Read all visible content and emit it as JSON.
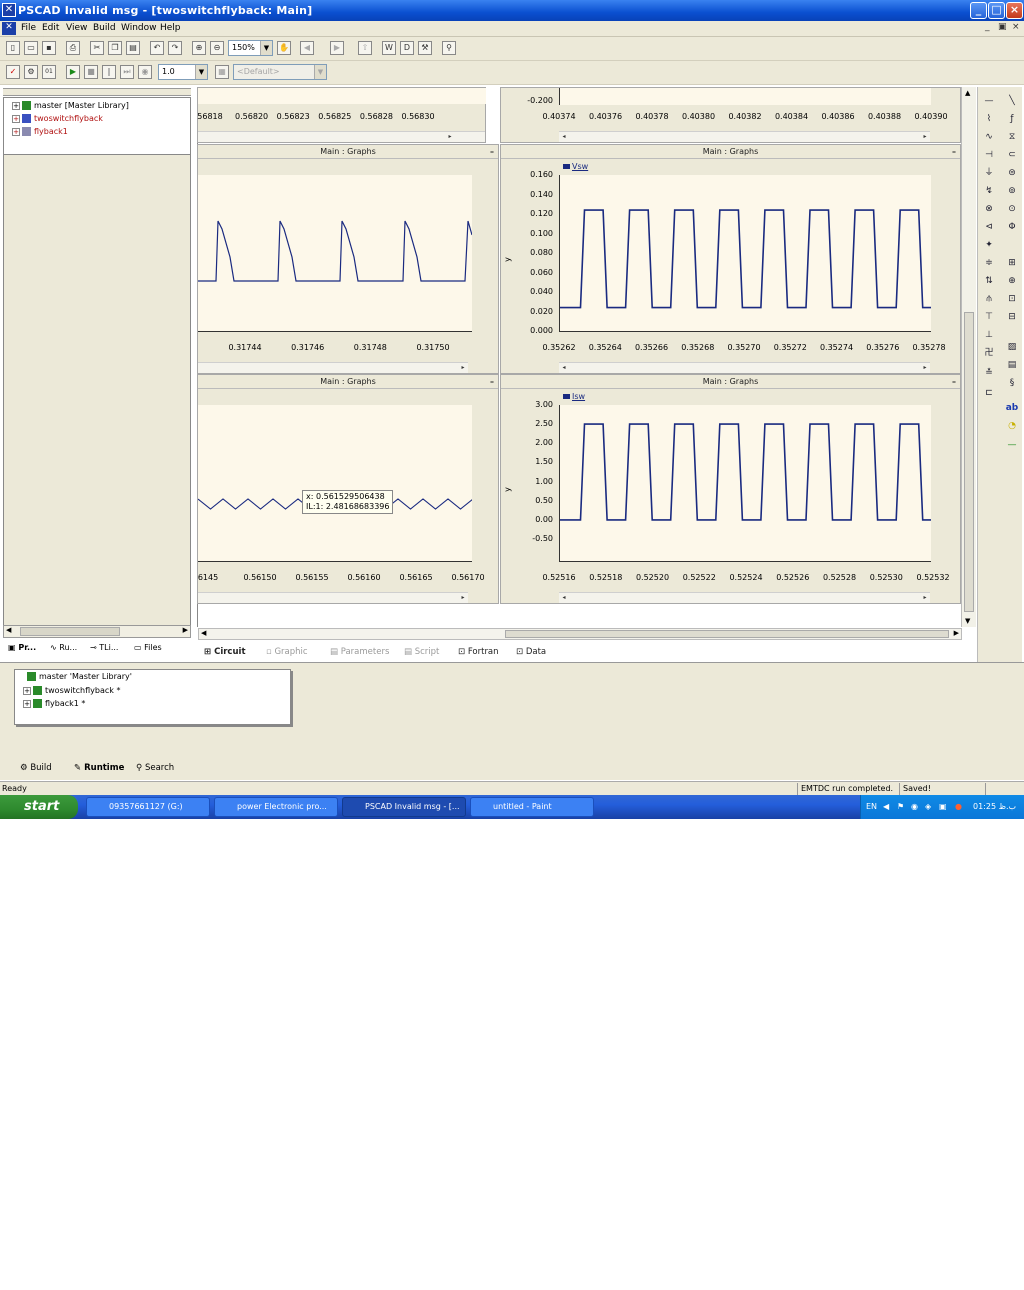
{
  "window": {
    "title": "PSCAD Invalid msg - [twoswitchflyback: Main]"
  },
  "menu": [
    "File",
    "Edit",
    "View",
    "Build",
    "Window",
    "Help"
  ],
  "toolbar": {
    "zoom": "150%",
    "sim_value": "1.0",
    "default_combo": "<Default>"
  },
  "project_tree": [
    {
      "label": "master [Master Library]",
      "color": "#000000"
    },
    {
      "label": "twoswitchflyback",
      "color": "#b01010"
    },
    {
      "label": "flyback1",
      "color": "#b01010"
    }
  ],
  "left_tabs": [
    "Pr...",
    "Ru...",
    "TLi...",
    "Files"
  ],
  "panels": {
    "top_left": {
      "xticks": [
        "56818",
        "0.56820",
        "0.56823",
        "0.56825",
        "0.56828",
        "0.56830"
      ]
    },
    "top_right": {
      "ytick": "-0.200",
      "xticks": [
        "0.40374",
        "0.40376",
        "0.40378",
        "0.40380",
        "0.40382",
        "0.40384",
        "0.40386",
        "0.40388",
        "0.40390"
      ]
    },
    "mid_left": {
      "header": "Main : Graphs",
      "xticks": [
        "0.31744",
        "0.31746",
        "0.31748",
        "0.31750"
      ]
    },
    "mid_right": {
      "header": "Main : Graphs",
      "legend": "Vsw",
      "ylabel": "y",
      "yticks": [
        "0.160",
        "0.140",
        "0.120",
        "0.100",
        "0.080",
        "0.060",
        "0.040",
        "0.020",
        "0.000"
      ],
      "xticks": [
        "0.35262",
        "0.35264",
        "0.35266",
        "0.35268",
        "0.35270",
        "0.35272",
        "0.35274",
        "0.35276",
        "0.35278"
      ]
    },
    "bot_left": {
      "header": "Main : Graphs",
      "xticks": [
        "6145",
        "0.56150",
        "0.56155",
        "0.56160",
        "0.56165",
        "0.56170"
      ],
      "tooltip_x": "x: 0.561529506438",
      "tooltip_y": "IL:1: 2.48168683396"
    },
    "bot_right": {
      "header": "Main : Graphs",
      "legend": "Isw",
      "ylabel": "y",
      "yticks": [
        "3.00",
        "2.50",
        "2.00",
        "1.50",
        "1.00",
        "0.50",
        "0.00",
        "-0.50"
      ],
      "xticks": [
        "0.52516",
        "0.52518",
        "0.52520",
        "0.52522",
        "0.52524",
        "0.52526",
        "0.52528",
        "0.52530",
        "0.52532"
      ]
    }
  },
  "chart_data": [
    {
      "type": "line",
      "title": "Main : Graphs",
      "series": [
        {
          "name": "Vsw",
          "values": [
            0.024,
            0.124,
            0.024,
            0.124,
            0.024,
            0.124,
            0.024,
            0.124,
            0.024,
            0.124,
            0.024,
            0.124,
            0.024,
            0.124,
            0.024,
            0.124,
            0.024
          ]
        }
      ],
      "ylabel": "y",
      "ylim": [
        0.0,
        0.16
      ],
      "xlim": [
        0.35262,
        0.35278
      ]
    },
    {
      "type": "line",
      "title": "Main : Graphs",
      "series": [
        {
          "name": "Isw",
          "values": [
            0.0,
            2.5,
            0.0,
            2.5,
            0.0,
            2.5,
            0.0,
            2.5,
            0.0,
            2.5,
            0.0,
            2.5,
            0.0,
            2.5,
            0.0,
            2.5,
            0.0
          ]
        }
      ],
      "ylabel": "y",
      "ylim": [
        -0.5,
        3.0
      ],
      "xlim": [
        0.52516,
        0.52532
      ]
    }
  ],
  "bottom_tabs": {
    "circuit": "Circuit",
    "graphic": "Graphic",
    "parameters": "Parameters",
    "script": "Script",
    "fortran": "Fortran",
    "data": "Data"
  },
  "runtime_tree": [
    "master 'Master Library'",
    "twoswitchflyback *",
    "flyback1 *"
  ],
  "runtime_tabs": {
    "build": "Build",
    "runtime": "Runtime",
    "search": "Search"
  },
  "status": {
    "left": "Ready",
    "run": "EMTDC run completed.",
    "saved": "Saved!"
  },
  "taskbar": {
    "start": "start",
    "tasks": [
      "09357661127 (G:)",
      "power Electronic pro...",
      "PSCAD Invalid msg - [...",
      "untitled - Paint"
    ],
    "lang": "EN",
    "clock": "01:25 ب.ظ"
  },
  "colors": {
    "trace": "#1a2a80",
    "plot_bg": "#fdf8ea",
    "title_blue": "#0a4fd0"
  }
}
